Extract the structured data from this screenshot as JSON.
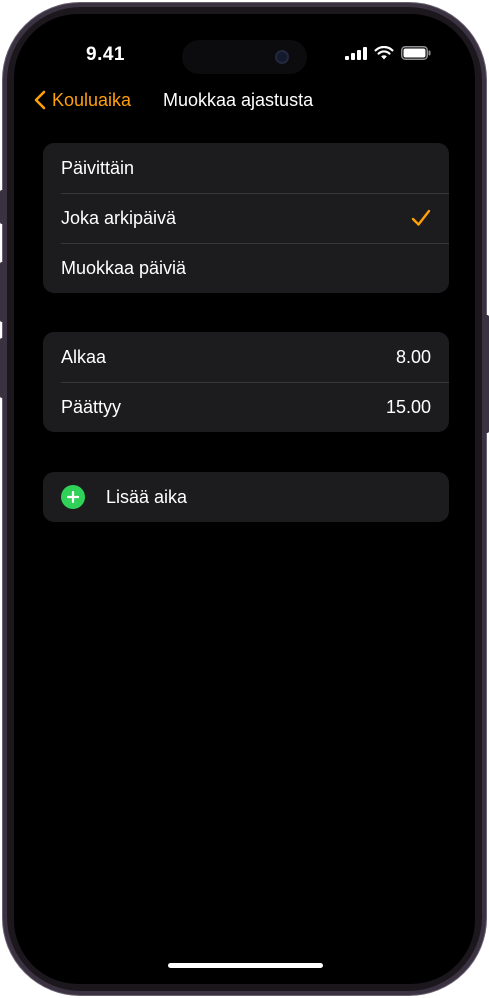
{
  "status_bar": {
    "time": "9.41",
    "icons": [
      "cellular-signal-icon",
      "wifi-icon",
      "battery-icon"
    ]
  },
  "nav": {
    "back_label": "Kouluaika",
    "title": "Muokkaa ajastusta"
  },
  "frequency": {
    "options": [
      {
        "label": "Päivittäin",
        "selected": false
      },
      {
        "label": "Joka arkipäivä",
        "selected": true
      },
      {
        "label": "Muokkaa päiviä",
        "selected": false
      }
    ]
  },
  "times": {
    "start_label": "Alkaa",
    "start_value": "8.00",
    "end_label": "Päättyy",
    "end_value": "15.00"
  },
  "add_time": {
    "label": "Lisää aika"
  },
  "colors": {
    "accent": "#ff9f0a",
    "add_green": "#30d158",
    "group_bg": "#1c1c1e",
    "separator": "#38383a",
    "background": "#000000"
  }
}
